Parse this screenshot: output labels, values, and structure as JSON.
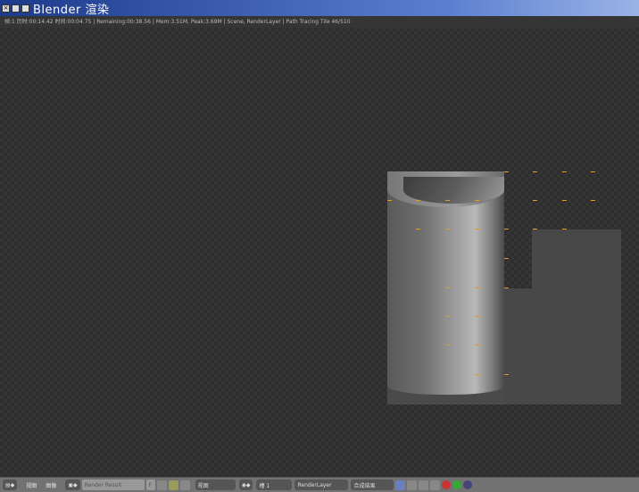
{
  "window": {
    "title": "Blender 渲染",
    "icons": [
      "close-icon",
      "minimize-icon",
      "maximize-icon"
    ]
  },
  "status": {
    "text": "帧:1 历时:00:14.42 时间:00:04.75 | Remaining:00:38.56 | Mem:3.51M, Peak:3.69M | Scene, RenderLayer | Path Tracing Tile 46/510"
  },
  "toolbar": {
    "view_menu": "视图",
    "image_menu": "图像",
    "image_name": "Render Result",
    "fake_user": "F",
    "view_select": "视图",
    "slot_select": "槽 1",
    "layer_select": "RenderLayer",
    "pass_select": "合成结果"
  },
  "colors": {
    "tile_marker": "#e09a2a",
    "titlebar": "#1c3a8c"
  }
}
